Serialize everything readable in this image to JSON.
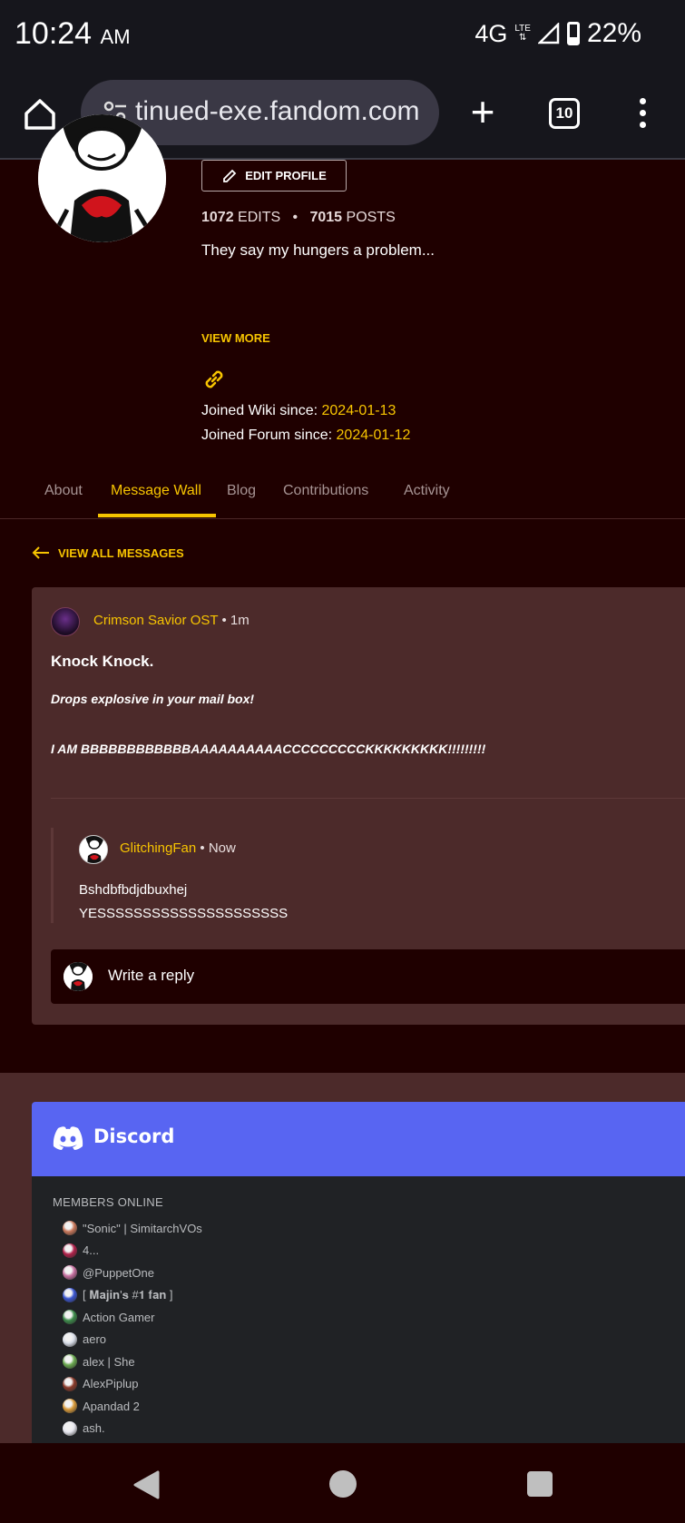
{
  "status_bar": {
    "time": "10:24",
    "ampm": "AM",
    "network": "4G",
    "lte": "LTE",
    "battery": "22%"
  },
  "browser": {
    "url": "tinued-exe.fandom.com",
    "tab_count": "10"
  },
  "profile": {
    "edit_label": "EDIT PROFILE",
    "edits_count": "1072",
    "edits_label": "EDITS",
    "posts_count": "7015",
    "posts_label": "POSTS",
    "separator": "•",
    "bio": "They say my hungers a problem...",
    "view_more": "VIEW MORE",
    "joined_wiki_label": "Joined Wiki since:",
    "joined_wiki_date": "2024-01-13",
    "joined_forum_label": "Joined Forum since:",
    "joined_forum_date": "2024-01-12"
  },
  "tabs": [
    {
      "label": "About"
    },
    {
      "label": "Message Wall"
    },
    {
      "label": "Blog"
    },
    {
      "label": "Contributions"
    },
    {
      "label": "Activity"
    }
  ],
  "view_all_messages": "VIEW ALL MESSAGES",
  "message": {
    "author": "Crimson Savior OST",
    "dot": "•",
    "time": "1m",
    "title": "Knock Knock.",
    "line1": "Drops explosive in your mail box!",
    "line2": "I AM BBBBBBBBBBBBAAAAAAAAAACCCCCCCCCKKKKKKKKK!!!!!!!!!"
  },
  "reply": {
    "author": "GlitchingFan",
    "dot": "•",
    "time": "Now",
    "line1": "Bshdbfbdjdbuxhej",
    "line2": "YESSSSSSSSSSSSSSSSSSSSS"
  },
  "write_reply_label": "Write a reply",
  "discord": {
    "title": "Discord",
    "members_label": "MEMBERS ONLINE",
    "members": [
      {
        "name": "\"Sonic\" | SimitarchVOs",
        "color": "#c9785b"
      },
      {
        "name": "4...",
        "color": "#b0204a"
      },
      {
        "name": "@PuppetOne",
        "color": "#c66fa0"
      },
      {
        "name": "[ 𝐌𝐚𝐣𝐢𝐧'𝐬 #𝟏 𝐟𝐚𝐧 ]",
        "color": "#3a55d0"
      },
      {
        "name": "Action Gamer",
        "color": "#3c8a4a"
      },
      {
        "name": "aero",
        "color": "#d8dde8"
      },
      {
        "name": "alex | She",
        "color": "#6aa84f"
      },
      {
        "name": "AlexPiplup",
        "color": "#8a3a2a"
      },
      {
        "name": "Apandad 2",
        "color": "#d89a3a"
      },
      {
        "name": "ash.",
        "color": "#e6e6ee"
      }
    ]
  }
}
